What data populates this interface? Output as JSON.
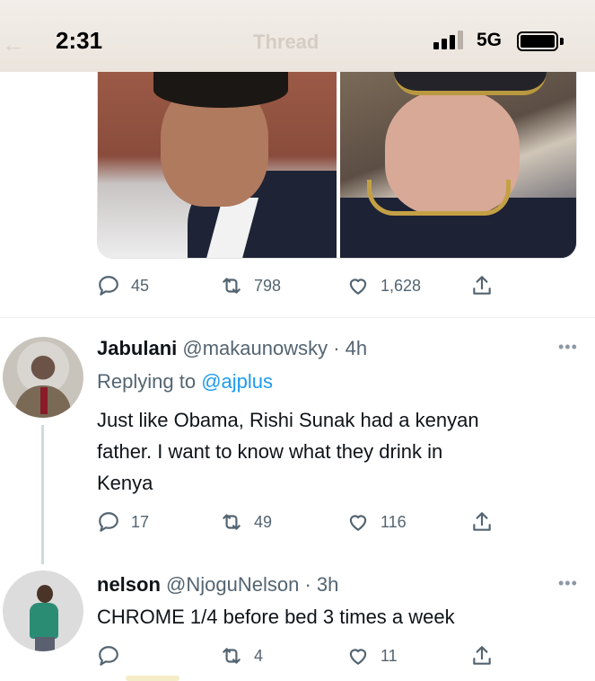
{
  "status_bar": {
    "time": "2:31",
    "network": "5G",
    "header_title": "Thread",
    "icons": [
      "back-arrow-icon",
      "signal-icon",
      "battery-icon"
    ]
  },
  "top_tweet_actions": {
    "replies": "45",
    "retweets": "798",
    "likes": "1,628"
  },
  "tweets": [
    {
      "name": "Jabulani",
      "handle": "@makaunowsky",
      "time": "· 4h",
      "replying_prefix": "Replying to",
      "replying_to": "@ajplus",
      "text_lines": [
        "Just like Obama, Rishi Sunak had a kenyan",
        "father. I want to know what they drink in",
        "Kenya"
      ],
      "replies": "17",
      "retweets": "49",
      "likes": "116"
    },
    {
      "name": "nelson",
      "handle": "@NjoguNelson",
      "time": "· 3h",
      "text_lines": [
        "CHROME 1/4  before bed 3 times a week"
      ],
      "replies": "",
      "retweets": "4",
      "likes": "11"
    }
  ],
  "colors": {
    "accent": "#1d9bf0",
    "secondary_text": "#536471",
    "primary_text": "#0f1419"
  }
}
